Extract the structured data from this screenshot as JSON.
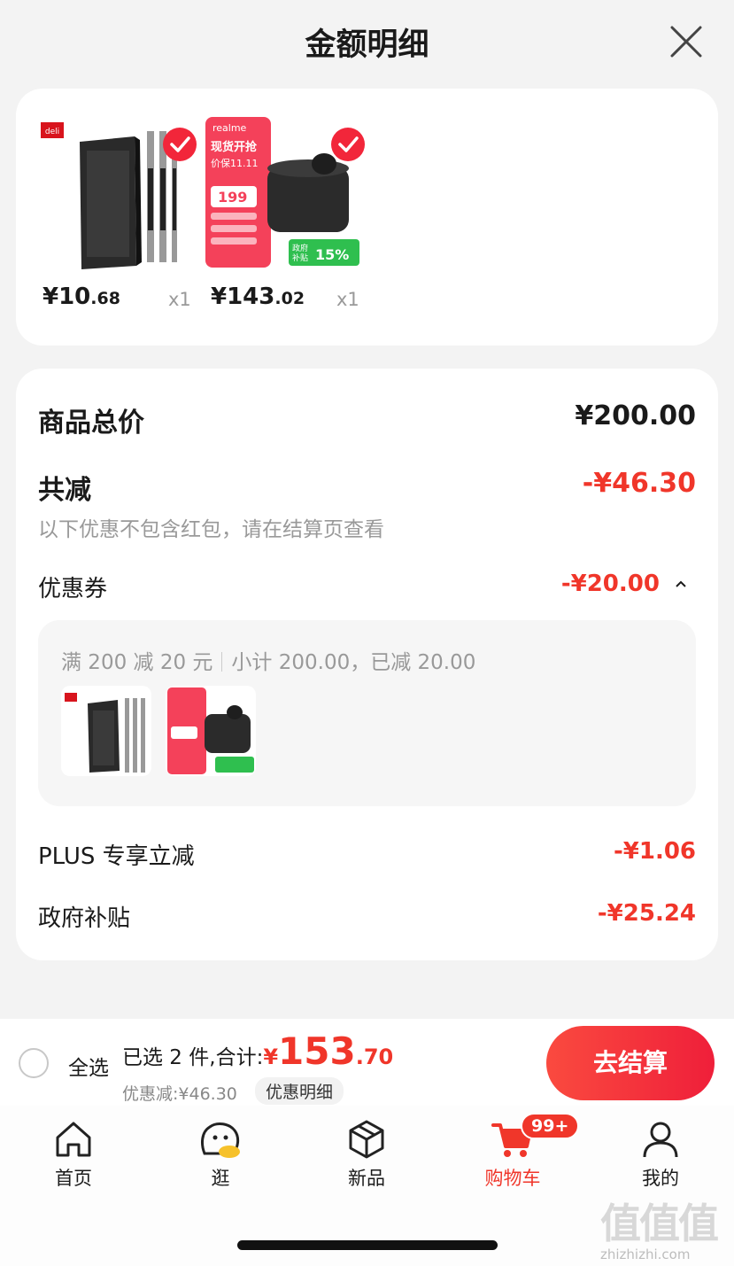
{
  "header": {
    "title": "金额明细"
  },
  "products": [
    {
      "brand_logo": "deli",
      "price_int": "¥10",
      "price_dec": ".68",
      "qty": "x1"
    },
    {
      "brand_logo": "realme",
      "promo_headline": "现货开抢",
      "promo_sub": "价保11.11",
      "promo_price": "199",
      "promo_subsidy_a": "政府",
      "promo_subsidy_b": "补贴",
      "promo_subsidy_pct": "15%",
      "price_int": "¥143",
      "price_dec": ".02",
      "qty": "x1"
    }
  ],
  "details": {
    "total_label": "商品总价",
    "total_value": "¥200.00",
    "reduce_label": "共减",
    "reduce_value": "-¥46.30",
    "reduce_note": "以下优惠不包含红包，请在结算页查看",
    "coupon_label": "优惠券",
    "coupon_value": "-¥20.00",
    "coupon_rule": "满 200 减 20 元",
    "coupon_summary": "小计 200.00，已减 20.00",
    "plus_label": "PLUS 专享立减",
    "plus_value": "-¥1.06",
    "gov_label": "政府补贴",
    "gov_value": "-¥25.24"
  },
  "bottom": {
    "select_all": "全选",
    "selected_text": "已选 2 件,合计:",
    "total_currency": "¥",
    "total_int": "153",
    "total_dec": ".70",
    "discount_text": "优惠减:¥46.30",
    "discount_detail": "优惠明细",
    "checkout": "去结算"
  },
  "tabbar": {
    "tabs": [
      {
        "label": "首页",
        "icon": "home-icon"
      },
      {
        "label": "逛",
        "icon": "explore-icon"
      },
      {
        "label": "新品",
        "icon": "box-icon"
      },
      {
        "label": "购物车",
        "icon": "cart-icon"
      },
      {
        "label": "我的",
        "icon": "user-icon"
      }
    ],
    "cart_badge": "99+"
  },
  "watermark": {
    "chars": "值值值",
    "url": "zhizhizhi.com"
  },
  "colors": {
    "accent": "#f0362a",
    "checkout_start": "#fa4a3f",
    "checkout_end": "#ef1f3a",
    "bg": "#f3f3f3"
  }
}
